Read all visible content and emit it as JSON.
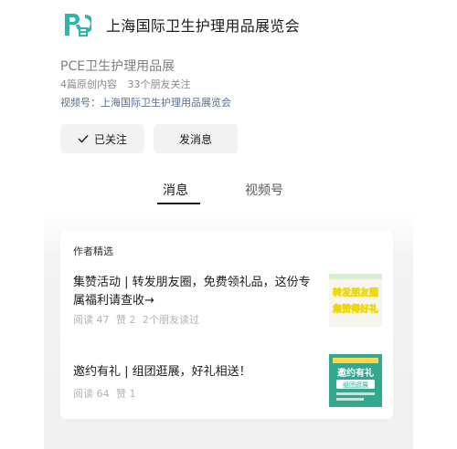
{
  "account": {
    "name": "上海国际卫生护理用品展览会",
    "subname": "PCE卫生护理用品展",
    "original_count": "4篇原创内容",
    "friends_follow": "33个朋友关注",
    "video_account": "视频号：上海国际卫生护理用品展览会"
  },
  "actions": {
    "follow_label": "已关注",
    "message_label": "发消息"
  },
  "tabs": [
    {
      "label": "消息",
      "active": true
    },
    {
      "label": "视频号",
      "active": false
    }
  ],
  "featured": {
    "label": "作者精选",
    "articles": [
      {
        "title": "集赞活动 | 转发朋友圈，免费领礼品，这份专属福利请查收→",
        "reads": "阅读 47",
        "likes": "赞 2",
        "friends": "2个朋友读过",
        "thumb_text_1": "转发朋友圈",
        "thumb_text_2": "集赞得好礼"
      },
      {
        "title": "邀约有礼 | 组团逛展，好礼相送！",
        "reads": "阅读 64",
        "likes": "赞 1",
        "thumb_text_1": "邀约有礼",
        "thumb_text_2": "组团逛展"
      }
    ]
  },
  "colors": {
    "brand_teal": "#2bb8a8",
    "link_blue": "#576b95",
    "thumb_green": "#33a88e"
  }
}
